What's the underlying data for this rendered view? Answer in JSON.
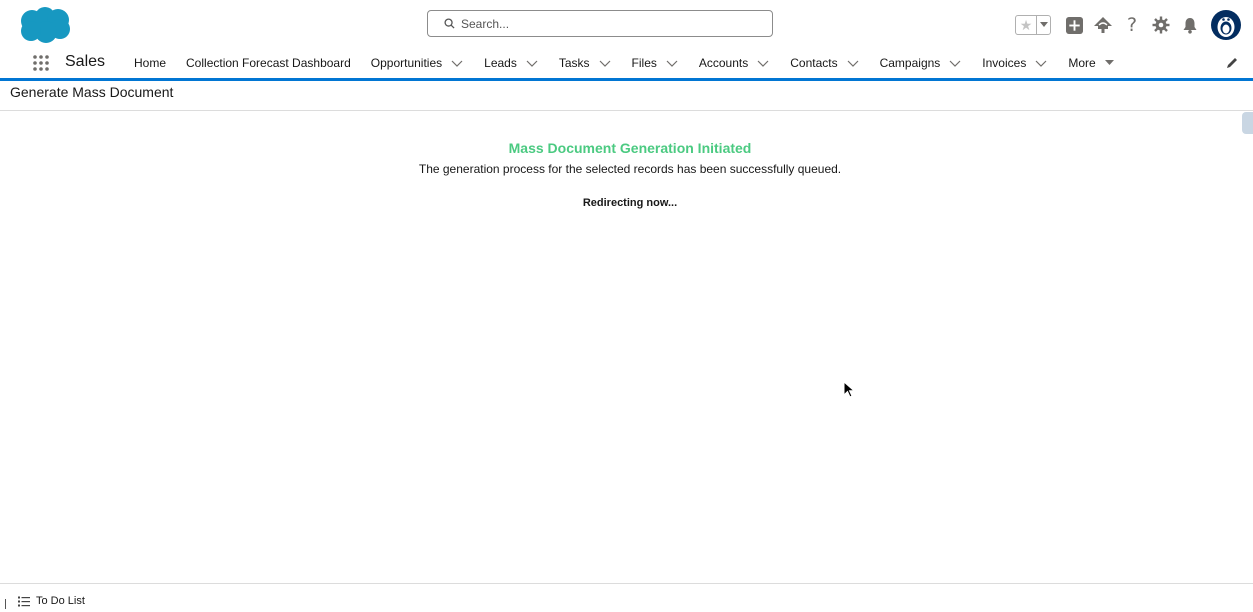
{
  "header": {
    "search": {
      "placeholder": "Search..."
    },
    "icons": [
      "favorites-star-icon",
      "add-icon",
      "trailhead-icon",
      "help-icon",
      "setup-gear-icon",
      "notifications-bell-icon",
      "user-avatar"
    ]
  },
  "nav": {
    "app_name": "Sales",
    "items": [
      {
        "label": "Home",
        "dropdown": false
      },
      {
        "label": "Collection Forecast Dashboard",
        "dropdown": false
      },
      {
        "label": "Opportunities",
        "dropdown": true
      },
      {
        "label": "Leads",
        "dropdown": true
      },
      {
        "label": "Tasks",
        "dropdown": true
      },
      {
        "label": "Files",
        "dropdown": true
      },
      {
        "label": "Accounts",
        "dropdown": true
      },
      {
        "label": "Contacts",
        "dropdown": true
      },
      {
        "label": "Campaigns",
        "dropdown": true
      },
      {
        "label": "Invoices",
        "dropdown": true
      },
      {
        "label": "More",
        "dropdown": true
      }
    ]
  },
  "page": {
    "title": "Generate Mass Document"
  },
  "message": {
    "title": "Mass Document Generation Initiated",
    "body": "The generation process for the selected records has been successfully queued.",
    "redirect": "Redirecting now..."
  },
  "footer": {
    "todo_label": "To Do List"
  },
  "colors": {
    "brand_blue": "#0176d3",
    "success_green": "#4bca81",
    "logo_blue": "#1798c1"
  }
}
